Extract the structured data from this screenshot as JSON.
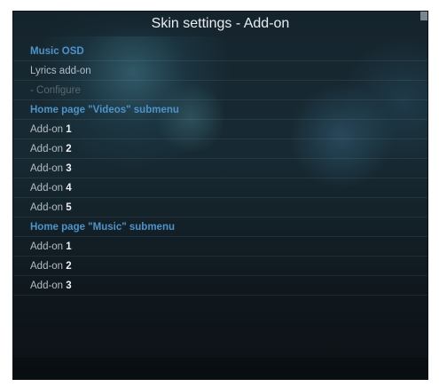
{
  "dialog": {
    "title": "Skin settings - Add-on"
  },
  "sections": {
    "music_osd": {
      "header": "Music OSD",
      "lyrics_label": "Lyrics add-on",
      "configure_label": "- Configure"
    },
    "videos": {
      "header": "Home page \"Videos\" submenu",
      "items": [
        {
          "prefix": "Add-on",
          "number": "1"
        },
        {
          "prefix": "Add-on",
          "number": "2"
        },
        {
          "prefix": "Add-on",
          "number": "3"
        },
        {
          "prefix": "Add-on",
          "number": "4"
        },
        {
          "prefix": "Add-on",
          "number": "5"
        }
      ]
    },
    "music": {
      "header": "Home page \"Music\" submenu",
      "items": [
        {
          "prefix": "Add-on",
          "number": "1"
        },
        {
          "prefix": "Add-on",
          "number": "2"
        },
        {
          "prefix": "Add-on",
          "number": "3"
        }
      ]
    }
  },
  "colors": {
    "section_header": "#4f93c9",
    "item_text": "#b4bdc3",
    "disabled_text": "#5b666d",
    "title_text": "#e9eef1"
  }
}
